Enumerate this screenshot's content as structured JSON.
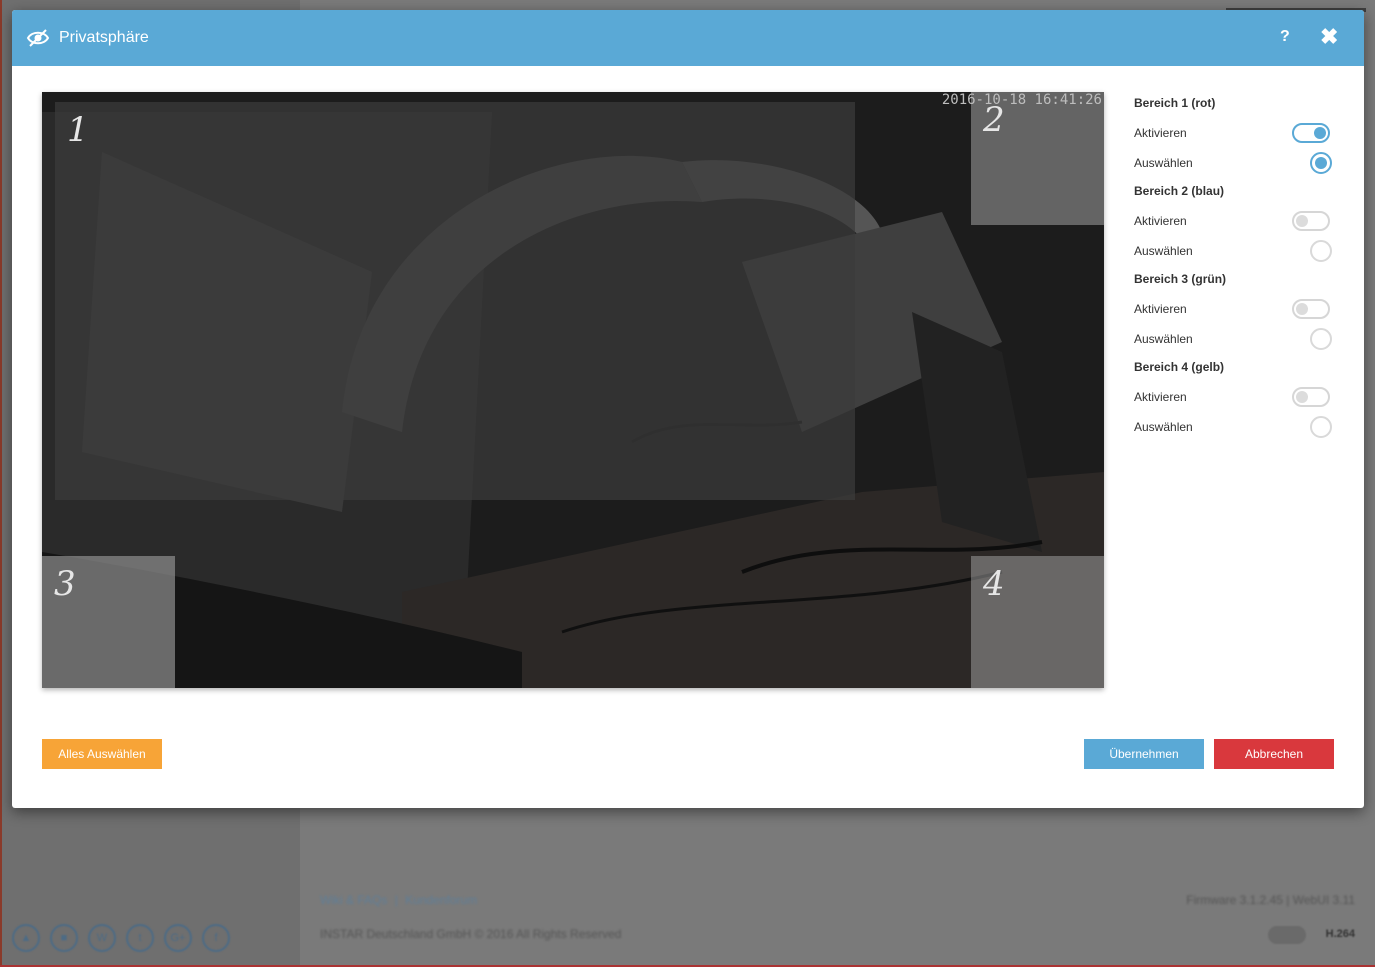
{
  "background": {
    "links": [
      "Wiki & FAQs",
      "|",
      "Kundenforum"
    ],
    "copyright": "INSTAR Deutschland GmbH © 2016 All Rights Reserved",
    "firmware": "Firmware 3.1.2.45 | WebUI 3.11",
    "codec": "H.264",
    "social_icons": [
      "home-icon",
      "camera-icon",
      "wordpress-icon",
      "twitter-icon",
      "google-plus-icon",
      "facebook-icon"
    ]
  },
  "modal": {
    "title": "Privatsphäre",
    "title_icon": "eye-icon",
    "help_label": "?",
    "close_label": "✖"
  },
  "video": {
    "timestamp": "2016-10-18 16:41:26",
    "areas": [
      {
        "number": "1",
        "color": "#3c3c3c"
      },
      {
        "number": "2",
        "color": "#c8c8c8"
      },
      {
        "number": "3",
        "color": "#8c8c8c"
      },
      {
        "number": "4",
        "color": "#bebebe"
      }
    ]
  },
  "areas_panel": [
    {
      "title": "Bereich 1 (rot)",
      "activate_label": "Aktivieren",
      "select_label": "Auswählen",
      "activated": true,
      "selected": true
    },
    {
      "title": "Bereich 2 (blau)",
      "activate_label": "Aktivieren",
      "select_label": "Auswählen",
      "activated": false,
      "selected": false
    },
    {
      "title": "Bereich 3 (grün)",
      "activate_label": "Aktivieren",
      "select_label": "Auswählen",
      "activated": false,
      "selected": false
    },
    {
      "title": "Bereich 4 (gelb)",
      "activate_label": "Aktivieren",
      "select_label": "Auswählen",
      "activated": false,
      "selected": false
    }
  ],
  "buttons": {
    "select_all": "Alles Auswählen",
    "apply": "Übernehmen",
    "cancel": "Abbrechen"
  },
  "colors": {
    "header": "#5aa9d6",
    "select_all": "#f7a437",
    "apply": "#5aa9d6",
    "cancel": "#d9383d"
  }
}
